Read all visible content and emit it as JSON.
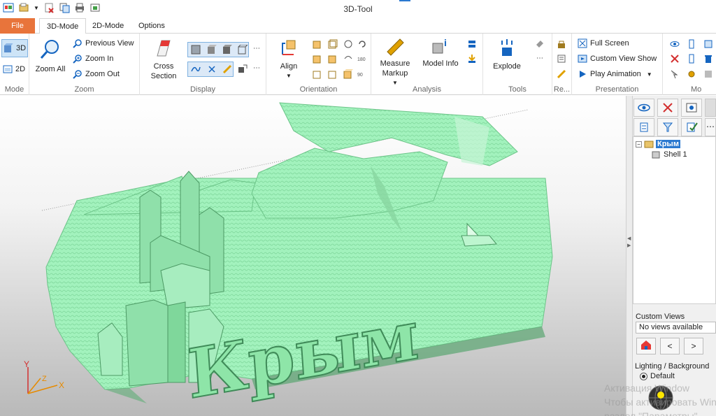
{
  "window": {
    "title": "3D-Tool"
  },
  "tabs": [
    {
      "label": "File"
    },
    {
      "label": "3D-Mode"
    },
    {
      "label": "2D-Mode"
    },
    {
      "label": "Options"
    }
  ],
  "ribbon": {
    "mode": {
      "label": "Mode",
      "btn3d": "3D",
      "btn2d": "2D"
    },
    "zoom": {
      "label": "Zoom",
      "zoom_all": "Zoom All",
      "previous_view": "Previous View",
      "zoom_in": "Zoom In",
      "zoom_out": "Zoom Out"
    },
    "display": {
      "label": "Display",
      "cross_section": "Cross\nSection",
      "cross_line1": "Cross",
      "cross_line2": "Section"
    },
    "orientation": {
      "label": "Orientation",
      "align": "Align"
    },
    "analysis": {
      "label": "Analysis",
      "measure_line1": "Measure",
      "measure_line2": "Markup",
      "model_info": "Model Info"
    },
    "tools": {
      "label": "Tools",
      "explode": "Explode"
    },
    "re": {
      "label": "Re..."
    },
    "presentation": {
      "label": "Presentation",
      "full_screen": "Full Screen",
      "custom_view_show": "Custom View Show",
      "play_animation": "Play Animation"
    },
    "mo": {
      "label": "Mo"
    }
  },
  "viewport": {
    "model_text": "Крым",
    "axis_y": "Y",
    "axis_z": "Z",
    "axis_x": "X",
    "model_color": "#9cf0b6"
  },
  "panel": {
    "tree": {
      "root": "Крым",
      "child": "Shell 1"
    },
    "custom_views_label": "Custom Views",
    "custom_views_value": "No views available",
    "prev": "<",
    "next": ">",
    "lighting_label": "Lighting / Background",
    "default_option": "Default"
  },
  "watermark": {
    "line1": "Активация Window",
    "line2": "Чтобы активировать Windo",
    "line3": "раздел \"Параметры\""
  }
}
